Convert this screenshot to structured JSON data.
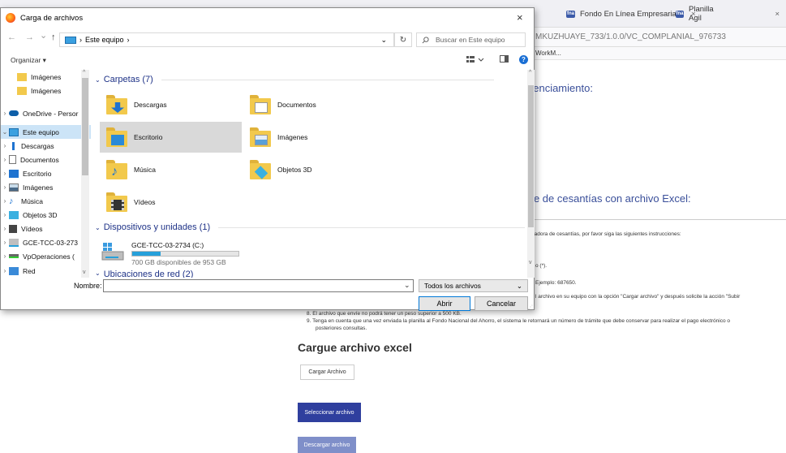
{
  "browser": {
    "tabs": [
      {
        "label": "Fondo En Línea Empresarial",
        "close": "×"
      },
      {
        "label": "Planilla Agil",
        "close": "×"
      }
    ],
    "favicon_text": "fna",
    "url_fragment": "MKUZHUAYE_733/1.0.0/VC_COMPLANIAL_976733",
    "bookmark": "WorkM...",
    "page": {
      "heading1_fragment": "genciamiento:",
      "heading2_fragment": "rte de cesantías con archivo Excel:",
      "instr_intro": "istradora de cesantías, por favor siga las siguientes instrucciones:",
      "instr_a": "o (*).",
      "instr_b": "Ejemplo: 687650.",
      "instr_c": "l archivo en su equipo con la opción \"Cargar archivo\" y después solicite la acción \"Subir",
      "instr_8": "8. El archivo que envíe no podrá tener un peso superior a 500 KB.",
      "instr_9a": "9. Tenga en cuenta que una vez enviada la planilla al Fondo Nacional del Ahorro, el sistema le retornará un número de trámite que debe conservar para realizar el pago electrónico o",
      "instr_9b": "posteriores consultas.",
      "cargue_title": "Cargue archivo excel",
      "btn_cargar": "Cargar Archivo",
      "btn_seleccionar": "Seleccionar archivo",
      "btn_descargar": "Descargar archivo"
    }
  },
  "dialog": {
    "title": "Carga de archivos",
    "close": "×",
    "nav": {
      "back": "←",
      "forward": "→",
      "recent": "⌄",
      "up": "↑"
    },
    "path": {
      "sep": "›",
      "location": "Este equipo",
      "dropdown": "⌄",
      "refresh": "↻"
    },
    "search_placeholder": "Buscar en Este equipo",
    "organize": "Organizar ▾",
    "sidebar": [
      {
        "label": "Imágenes"
      },
      {
        "label": "Imágenes"
      },
      {
        "label": "OneDrive - Persor"
      },
      {
        "label": "Este equipo"
      },
      {
        "label": "Descargas"
      },
      {
        "label": "Documentos"
      },
      {
        "label": "Escritorio"
      },
      {
        "label": "Imágenes"
      },
      {
        "label": "Música"
      },
      {
        "label": "Objetos 3D"
      },
      {
        "label": "Vídeos"
      },
      {
        "label": "GCE-TCC-03-273"
      },
      {
        "label": "VpOperaciones ("
      },
      {
        "label": "Red"
      }
    ],
    "groups": {
      "folders": "Carpetas (7)",
      "devices": "Dispositivos y unidades (1)",
      "network": "Ubicaciones de red (2)"
    },
    "folders": [
      {
        "label": "Descargas",
        "accent": "#1e73d0"
      },
      {
        "label": "Documentos",
        "accent": "#ffffff"
      },
      {
        "label": "Escritorio",
        "accent": "#2a8ad8"
      },
      {
        "label": "Imágenes",
        "accent": "#5aa0d8"
      },
      {
        "label": "Música",
        "accent": "#1e73d0"
      },
      {
        "label": "Objetos 3D",
        "accent": "#3ab0e0"
      },
      {
        "label": "Vídeos",
        "accent": "#333333"
      }
    ],
    "drive": {
      "name": "GCE-TCC-03-2734 (C:)",
      "free": "700 GB disponibles de 953 GB",
      "used_fraction": 0.27
    },
    "filename_label": "Nombre:",
    "filename_value": "",
    "filter": "Todos los archivos",
    "filter_chev": "⌄",
    "open": "Abrir",
    "cancel": "Cancelar"
  }
}
